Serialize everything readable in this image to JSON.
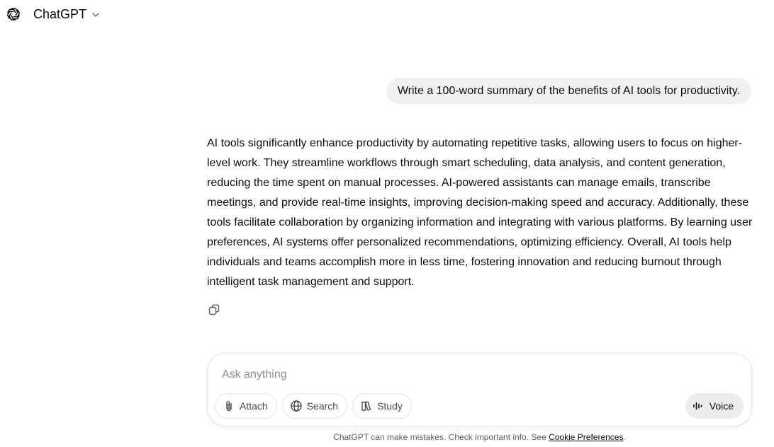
{
  "header": {
    "model_name": "ChatGPT"
  },
  "conversation": {
    "user_message": "Write a 100-word summary of the benefits of AI tools for productivity.",
    "assistant_message": "AI tools significantly enhance productivity by automating repetitive tasks, allowing users to focus on higher-level work. They streamline workflows through smart scheduling, data analysis, and content generation, reducing the time spent on manual processes. AI-powered assistants can manage emails, transcribe meetings, and provide real-time insights, improving decision-making speed and accuracy. Additionally, these tools facilitate collaboration by organizing information and integrating with various platforms. By learning user preferences, AI systems offer personalized recommendations, optimizing efficiency. Overall, AI tools help individuals and teams accomplish more in less time, fostering innovation and reducing burnout through intelligent task management and support."
  },
  "composer": {
    "placeholder": "Ask anything",
    "value": "",
    "tools": {
      "attach": "Attach",
      "search": "Search",
      "study": "Study"
    },
    "voice_label": "Voice"
  },
  "footer": {
    "disclaimer": "ChatGPT can make mistakes. Check important info. See ",
    "link_text": "Cookie Preferences",
    "suffix": "."
  },
  "icons": {
    "logo": "openai-logo-icon",
    "chevron": "chevron-down-icon",
    "copy": "copy-icon",
    "attach": "paperclip-icon",
    "search": "globe-icon",
    "study": "book-icon",
    "voice": "waveform-icon"
  },
  "colors": {
    "user_bubble": "#f1f1f1",
    "voice_button": "#ececec",
    "text": "#0d0d0d"
  }
}
